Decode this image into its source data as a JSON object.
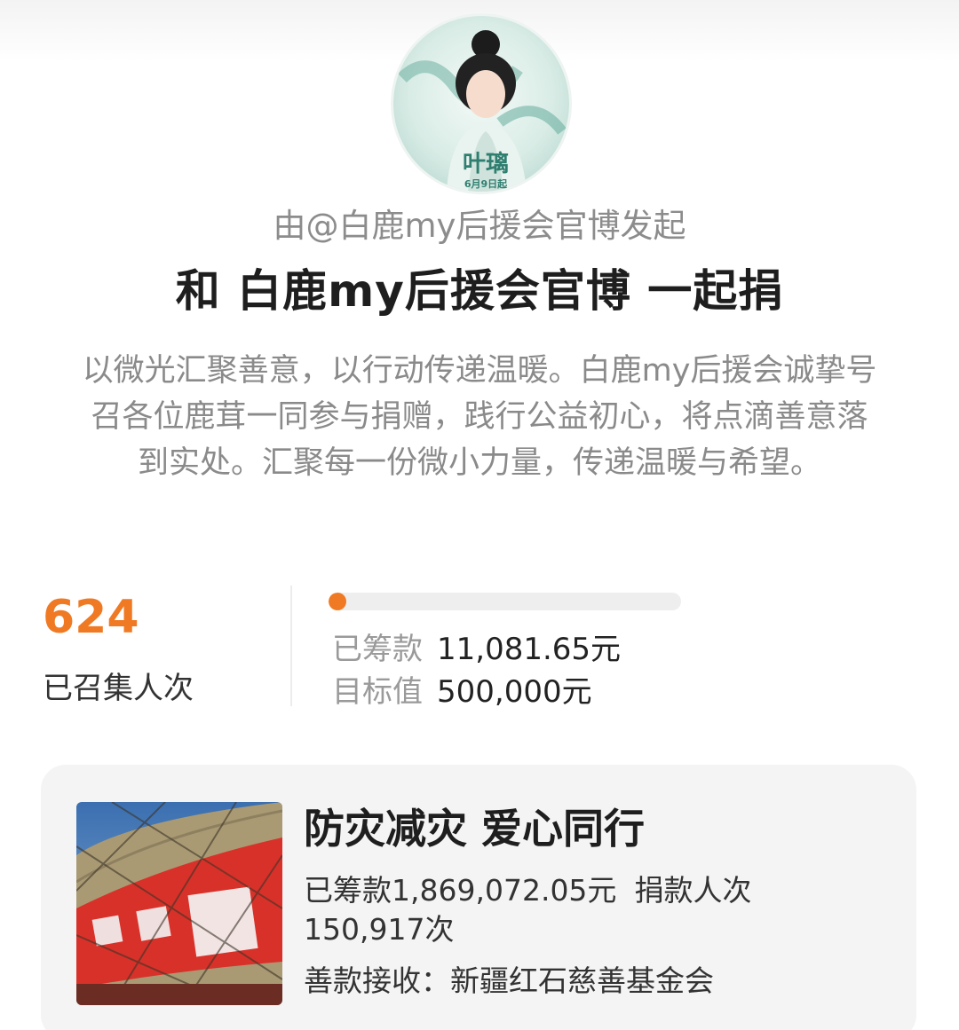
{
  "initiator": {
    "text": "由@白鹿my后援会官博发起"
  },
  "headline": {
    "text": "和 白鹿my后援会官博 一起捐"
  },
  "description": {
    "text": "以微光汇聚善意，以行动传递温暖。白鹿my后援会诚挚号召各位鹿茸一同参与捐赠，践行公益初心，将点滴善意落到实处。汇聚每一份微小力量，传递温暖与希望。"
  },
  "avatar": {
    "icon": "profile-avatar",
    "poster_name": "叶璃",
    "poster_date": "6月9日起"
  },
  "participants": {
    "count": "624",
    "label": "已召集人次"
  },
  "progress": {
    "fraction": 0.022,
    "raised_label": "已筹款",
    "raised_value": "11,081.65元",
    "target_label": "目标值",
    "target_value": "500,000元",
    "accent_color": "#f07a24"
  },
  "project_card": {
    "title": "防灾减灾 爱心同行",
    "raised": "已筹款1,869,072.05元",
    "donors": "捐款人次150,917次",
    "recipient": "善款接收：新疆红石慈善基金会",
    "image_icon": "relief-truck-image"
  }
}
